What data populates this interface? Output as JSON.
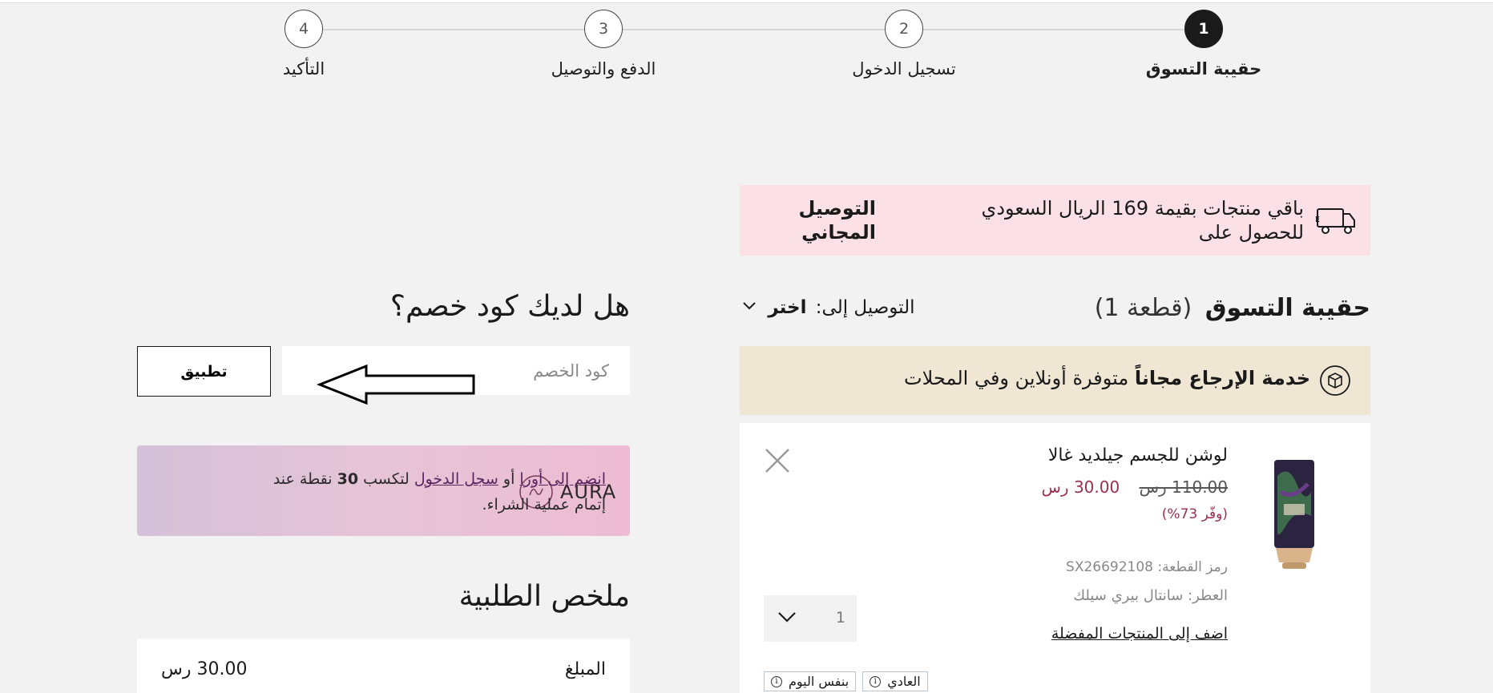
{
  "stepper": {
    "steps": [
      {
        "number": "1",
        "label": "حقيبة التسوق"
      },
      {
        "number": "2",
        "label": "تسجيل الدخول"
      },
      {
        "number": "3",
        "label": "الدفع والتوصيل"
      },
      {
        "number": "4",
        "label": "التأكيد"
      }
    ],
    "active_step": "1"
  },
  "free_banner": {
    "icon": "free-delivery-truck-icon",
    "message": "باقي منتجات بقيمة 169 الريال السعودي للحصول على",
    "title": "التوصيل المجاني"
  },
  "bag": {
    "title": "حقيبة التسوق",
    "count": "(قطعة 1)",
    "deliver_to_label": "التوصيل إلى:",
    "deliver_to_value": "اختر"
  },
  "return_banner": {
    "icon": "return-box-icon",
    "bold": "خدمة الإرجاع مجاناً",
    "text": "متوفرة أونلاين وفي المحلات"
  },
  "product": {
    "name": "لوشن للجسم جيلديد غالا",
    "old_price": "110.00 رس",
    "new_price": "30.00 رس",
    "save": "(وفّر 73%)",
    "sku": "رمز القطعة: SX26692108",
    "scent": "العطر: سانتال بيري سيلك",
    "add_favorites": "اضف إلى المنتجات المفضلة",
    "quantity": "1",
    "shipping_tags": [
      "العادي",
      "بنفس اليوم"
    ]
  },
  "coupon": {
    "title": "هل لديك كود خصم؟",
    "placeholder": "كود الخصم",
    "apply": "تطبيق"
  },
  "aura": {
    "logo_text": "AURA",
    "join_link": "انضم إلى أورا",
    "or": "أو",
    "login_link": "سجل الدخول",
    "earn_prefix": "لتكسب",
    "points": "30",
    "earn_suffix": "نقطة عند إتمام عملية الشراء."
  },
  "summary": {
    "title": "ملخص الطلبية",
    "amount_label": "المبلغ",
    "amount_value": "30.00 رس"
  },
  "colors": {
    "background": "#f2f2f2",
    "free_banner_bg": "#fbe1e6",
    "return_banner_bg": "#efe6d3",
    "price_accent": "#9b2f4e",
    "aura_link": "#5b2461"
  }
}
